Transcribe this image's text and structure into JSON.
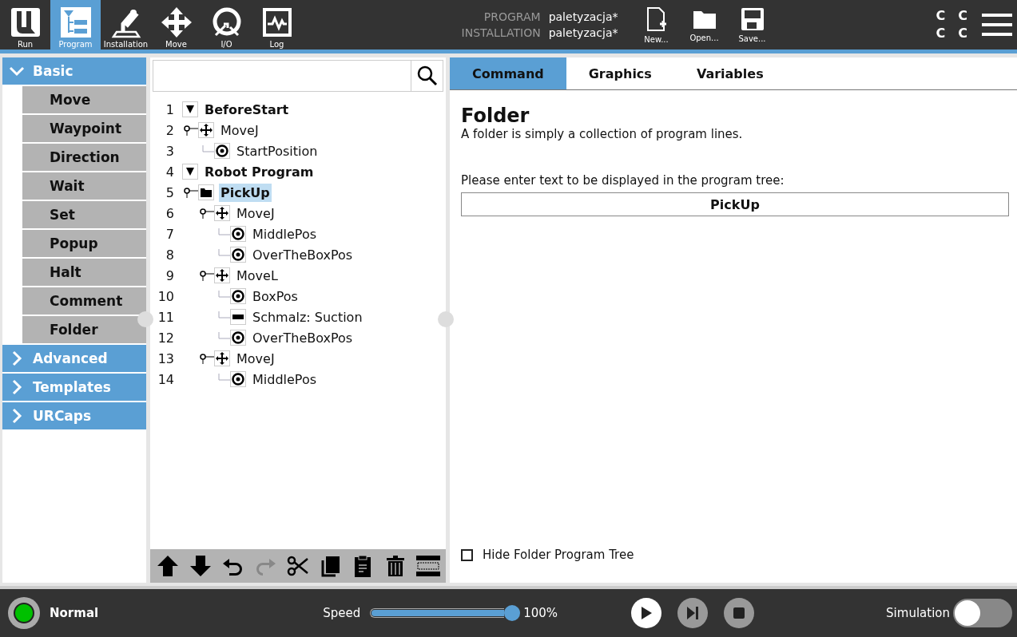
{
  "nav": [
    {
      "kind": "run",
      "label": "Run",
      "selected": false
    },
    {
      "kind": "program",
      "label": "Program",
      "selected": true
    },
    {
      "kind": "installation",
      "label": "Installation",
      "selected": false
    },
    {
      "kind": "move",
      "label": "Move",
      "selected": false
    },
    {
      "kind": "io",
      "label": "I/O",
      "selected": false
    },
    {
      "kind": "log",
      "label": "Log",
      "selected": false
    }
  ],
  "file_info": [
    {
      "label": "PROGRAM",
      "value": "paletyzacja*"
    },
    {
      "label": "INSTALLATION",
      "value": "paletyzacja*"
    }
  ],
  "file_actions": [
    {
      "kind": "new",
      "label": "New..."
    },
    {
      "kind": "open",
      "label": "Open..."
    },
    {
      "kind": "save",
      "label": "Save..."
    }
  ],
  "status_glyphs": [
    "C",
    "C",
    "C",
    "C"
  ],
  "sidebar": [
    {
      "label": "Basic",
      "expanded": true,
      "items": [
        {
          "label": "Move"
        },
        {
          "label": "Waypoint"
        },
        {
          "label": "Direction"
        },
        {
          "label": "Wait"
        },
        {
          "label": "Set"
        },
        {
          "label": "Popup"
        },
        {
          "label": "Halt"
        },
        {
          "label": "Comment"
        },
        {
          "label": "Folder"
        }
      ]
    },
    {
      "label": "Advanced",
      "expanded": false
    },
    {
      "label": "Templates",
      "expanded": false
    },
    {
      "label": "URCaps",
      "expanded": false
    }
  ],
  "tree": [
    {
      "number": "1",
      "label": "BeforeStart",
      "kind": "expander",
      "expanded": true,
      "selected": false,
      "children": [
        {
          "number": "2",
          "label": "MoveJ",
          "kind": "move",
          "selected": false,
          "children": [
            {
              "number": "3",
              "label": "StartPosition",
              "kind": "waypoint",
              "selected": false
            }
          ]
        }
      ]
    },
    {
      "number": "4",
      "label": "Robot Program",
      "kind": "expander",
      "expanded": true,
      "selected": false,
      "children": [
        {
          "number": "5",
          "label": "PickUp",
          "kind": "folder",
          "selected": true,
          "children": [
            {
              "number": "6",
              "label": "MoveJ",
              "kind": "move",
              "selected": false,
              "children": [
                {
                  "number": "7",
                  "label": "MiddlePos",
                  "kind": "waypoint",
                  "selected": false
                },
                {
                  "number": "8",
                  "label": "OverTheBoxPos",
                  "kind": "waypoint",
                  "selected": false
                }
              ]
            },
            {
              "number": "9",
              "label": "MoveL",
              "kind": "move",
              "selected": false,
              "children": [
                {
                  "number": "10",
                  "label": "BoxPos",
                  "kind": "waypoint",
                  "selected": false
                },
                {
                  "number": "11",
                  "label": "Schmalz: Suction",
                  "kind": "urcap",
                  "selected": false
                },
                {
                  "number": "12",
                  "label": "OverTheBoxPos",
                  "kind": "waypoint",
                  "selected": false
                }
              ]
            },
            {
              "number": "13",
              "label": "MoveJ",
              "kind": "move",
              "selected": false,
              "children": [
                {
                  "number": "14",
                  "label": "MiddlePos",
                  "kind": "waypoint",
                  "selected": false
                }
              ]
            }
          ]
        }
      ]
    }
  ],
  "tree_toolbar": [
    {
      "kind": "up",
      "disabled": false
    },
    {
      "kind": "down",
      "disabled": false
    },
    {
      "kind": "undo",
      "disabled": false
    },
    {
      "kind": "redo",
      "disabled": true
    },
    {
      "kind": "cut",
      "disabled": false
    },
    {
      "kind": "copy",
      "disabled": false
    },
    {
      "kind": "paste",
      "disabled": false
    },
    {
      "kind": "delete",
      "disabled": false
    },
    {
      "kind": "suppress",
      "disabled": false
    }
  ],
  "tabs": [
    {
      "label": "Command",
      "selected": true
    },
    {
      "label": "Graphics",
      "selected": false
    },
    {
      "label": "Variables",
      "selected": false
    }
  ],
  "command": {
    "title": "Folder",
    "description": "A folder is simply a collection of program lines.",
    "field_label": "Please enter text to be displayed in the program tree:",
    "field_value": "PickUp",
    "checkbox": {
      "label": "Hide Folder Program Tree",
      "checked": false
    }
  },
  "footer": {
    "status": {
      "label": "Normal",
      "color": "#00c000"
    },
    "speed": {
      "label": "Speed",
      "level": 1.0,
      "reading": "100%"
    },
    "playback": [
      {
        "kind": "play",
        "disabled": false
      },
      {
        "kind": "step",
        "disabled": true
      },
      {
        "kind": "stop",
        "disabled": true
      }
    ],
    "simulation": {
      "label": "Simulation",
      "on": false
    }
  }
}
